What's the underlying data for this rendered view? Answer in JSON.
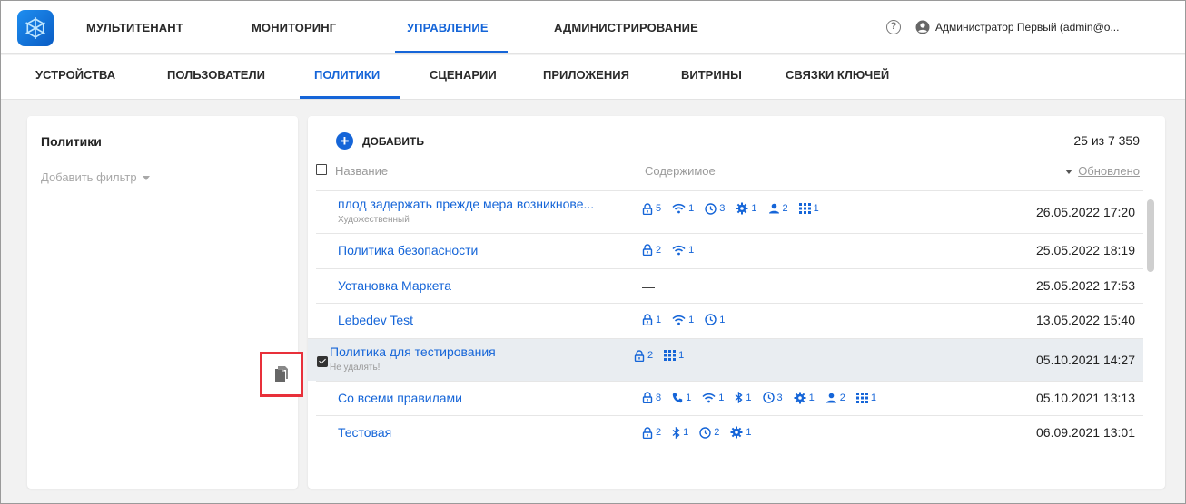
{
  "topnav": {
    "items": [
      {
        "label": "МУЛЬТИТЕНАНТ",
        "active": false
      },
      {
        "label": "МОНИТОРИНГ",
        "active": false
      },
      {
        "label": "УПРАВЛЕНИЕ",
        "active": true
      },
      {
        "label": "АДМИНИСТРИРОВАНИЕ",
        "active": false
      }
    ],
    "help_glyph": "?",
    "user_name": "Администратор Первый (admin@o..."
  },
  "subnav": {
    "items": [
      {
        "label": "УСТРОЙСТВА",
        "active": false
      },
      {
        "label": "ПОЛЬЗОВАТЕЛИ",
        "active": false
      },
      {
        "label": "ПОЛИТИКИ",
        "active": true
      },
      {
        "label": "СЦЕНАРИИ",
        "active": false
      },
      {
        "label": "ПРИЛОЖЕНИЯ",
        "active": false
      },
      {
        "label": "ВИТРИНЫ",
        "active": false
      },
      {
        "label": "СВЯЗКИ КЛЮЧЕЙ",
        "active": false
      }
    ]
  },
  "left_panel": {
    "title": "Политики",
    "filter_label": "Добавить фильтр"
  },
  "main": {
    "add_label": "ДОБАВИТЬ",
    "count": "25 из 7 359",
    "columns": {
      "name": "Название",
      "content": "Содержимое",
      "updated": "Обновлено"
    },
    "rows": [
      {
        "name": "плод задержать прежде мера возникнове...",
        "subtitle": "Художественный",
        "content": [
          {
            "icon": "lock-icon",
            "count": "5"
          },
          {
            "icon": "wifi-icon",
            "count": "1"
          },
          {
            "icon": "clock-icon",
            "count": "3"
          },
          {
            "icon": "gear-icon",
            "count": "1"
          },
          {
            "icon": "user-icon",
            "count": "2"
          },
          {
            "icon": "apps-grid-icon",
            "count": "1"
          }
        ],
        "date": "26.05.2022 17:20",
        "selected": false
      },
      {
        "name": "Политика безопасности",
        "subtitle": "",
        "content": [
          {
            "icon": "lock-icon",
            "count": "2"
          },
          {
            "icon": "wifi-icon",
            "count": "1"
          }
        ],
        "date": "25.05.2022 18:19",
        "selected": false
      },
      {
        "name": "Установка Маркета",
        "subtitle": "",
        "content_empty": "—",
        "content": [],
        "date": "25.05.2022 17:53",
        "selected": false
      },
      {
        "name": "Lebedev Test",
        "subtitle": "",
        "content": [
          {
            "icon": "lock-icon",
            "count": "1"
          },
          {
            "icon": "wifi-icon",
            "count": "1"
          },
          {
            "icon": "clock-icon",
            "count": "1"
          }
        ],
        "date": "13.05.2022 15:40",
        "selected": false
      },
      {
        "name": "Политика для тестирования",
        "subtitle": "Не удалять!",
        "content": [
          {
            "icon": "lock-icon",
            "count": "2"
          },
          {
            "icon": "apps-grid-icon",
            "count": "1"
          }
        ],
        "date": "05.10.2021 14:27",
        "selected": true
      },
      {
        "name": "Со всеми правилами",
        "subtitle": "",
        "content": [
          {
            "icon": "lock-icon",
            "count": "8"
          },
          {
            "icon": "phone-icon",
            "count": "1"
          },
          {
            "icon": "wifi-icon",
            "count": "1"
          },
          {
            "icon": "bluetooth-icon",
            "count": "1"
          },
          {
            "icon": "clock-icon",
            "count": "3"
          },
          {
            "icon": "gear-icon",
            "count": "1"
          },
          {
            "icon": "user-icon",
            "count": "2"
          },
          {
            "icon": "apps-grid-icon",
            "count": "1"
          }
        ],
        "date": "05.10.2021 13:13",
        "selected": false
      },
      {
        "name": "Тестовая",
        "subtitle": "",
        "content": [
          {
            "icon": "lock-icon",
            "count": "2"
          },
          {
            "icon": "bluetooth-icon",
            "count": "1"
          },
          {
            "icon": "clock-icon",
            "count": "2"
          },
          {
            "icon": "gear-icon",
            "count": "1"
          }
        ],
        "date": "06.09.2021 13:01",
        "selected": false
      }
    ]
  },
  "colors": {
    "accent": "#1565d8",
    "highlight_border": "#e8303a",
    "selected_row": "#e9edf1"
  }
}
